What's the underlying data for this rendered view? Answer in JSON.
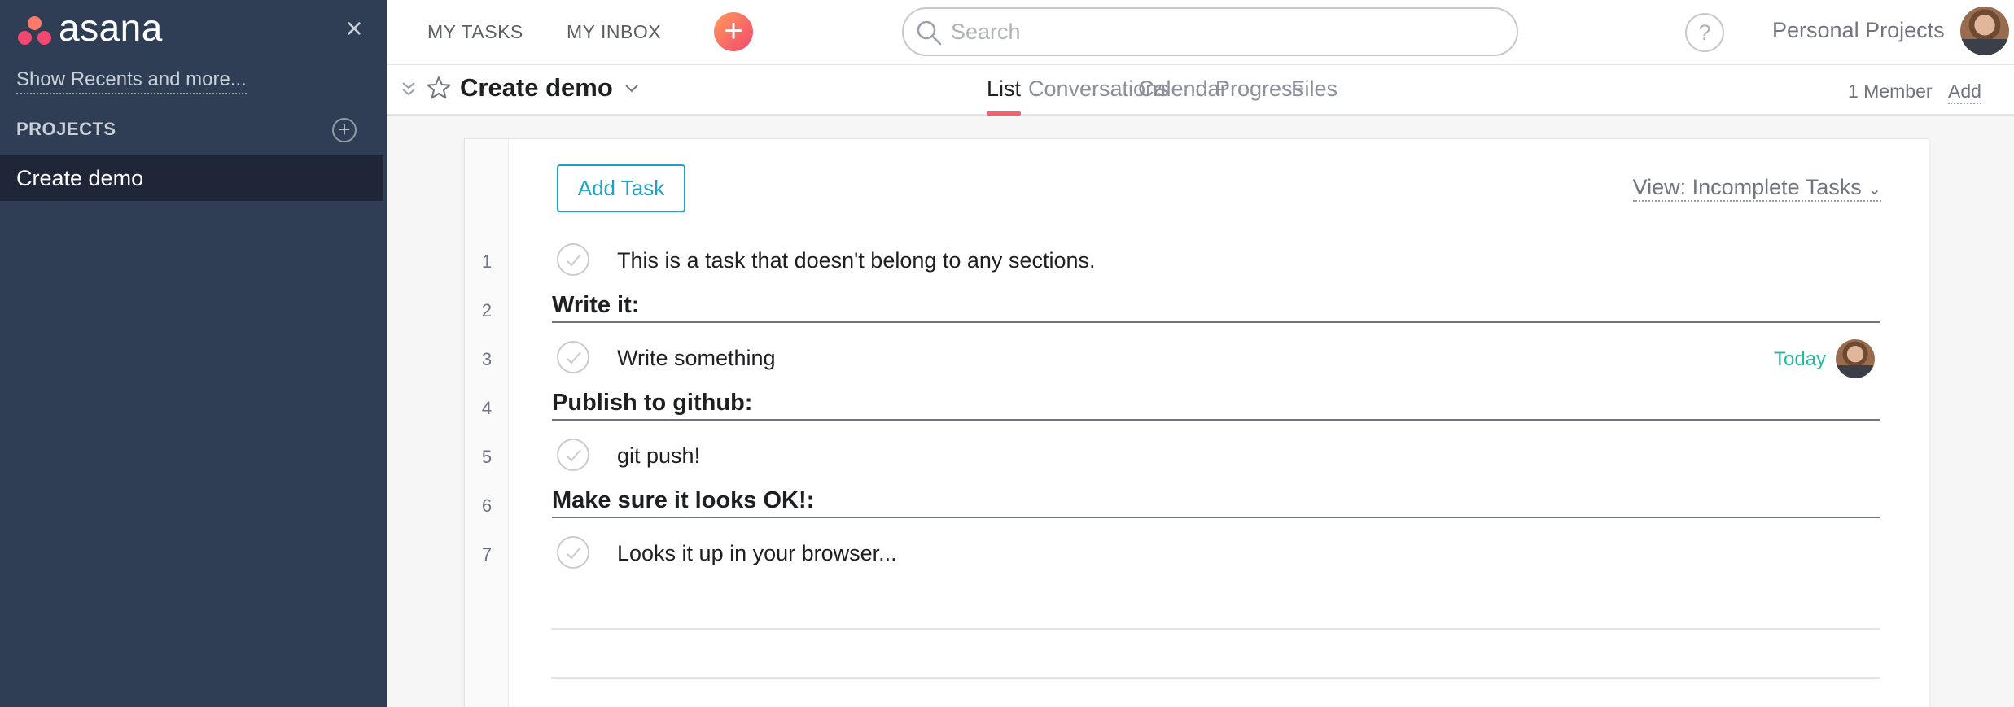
{
  "sidebar": {
    "logo_text": "asana",
    "recents_link": "Show Recents and more...",
    "projects_header": "PROJECTS",
    "projects": [
      {
        "label": "Create demo"
      }
    ]
  },
  "topbar": {
    "my_tasks": "MY TASKS",
    "my_inbox": "MY INBOX",
    "search_placeholder": "Search",
    "help": "?",
    "workspace": "Personal Projects"
  },
  "project": {
    "title": "Create demo",
    "tabs": [
      {
        "label": "List",
        "active": true
      },
      {
        "label": "Conversations",
        "active": false
      },
      {
        "label": "Calendar",
        "active": false
      },
      {
        "label": "Progress",
        "active": false
      },
      {
        "label": "Files",
        "active": false
      }
    ],
    "members": "1 Member",
    "add_member": "Add"
  },
  "list": {
    "add_task": "Add Task",
    "view_filter": "View: Incomplete Tasks",
    "rows": [
      {
        "line": "1",
        "type": "task",
        "text": "This is a task that doesn't belong to any sections."
      },
      {
        "line": "2",
        "type": "section",
        "text": "Write it:"
      },
      {
        "line": "3",
        "type": "task",
        "text": "Write something",
        "due": "Today"
      },
      {
        "line": "4",
        "type": "section",
        "text": "Publish to github:"
      },
      {
        "line": "5",
        "type": "task",
        "text": "git push!"
      },
      {
        "line": "6",
        "type": "section",
        "text": "Make sure it looks OK!:"
      },
      {
        "line": "7",
        "type": "task",
        "text": "Looks it up in your browser..."
      }
    ]
  },
  "colors": {
    "sidebar_bg": "#2f3d55",
    "accent": "#1aa3c8",
    "due_today": "#25b89a",
    "tab_underline": "#f2636f"
  }
}
